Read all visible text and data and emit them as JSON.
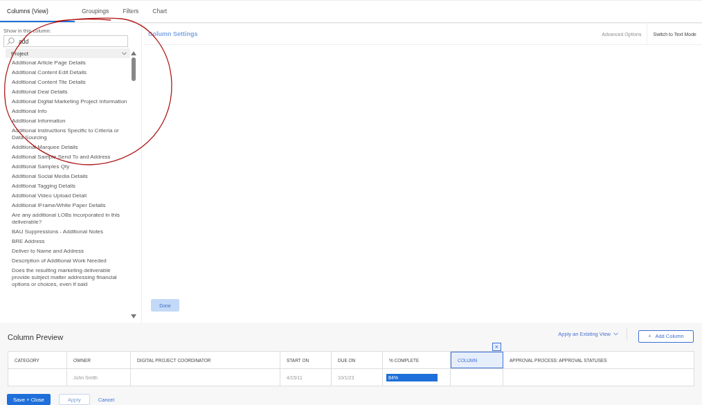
{
  "tabs": [
    {
      "label": "Columns (View)",
      "selected": true
    },
    {
      "label": "Groupings",
      "selected": false
    },
    {
      "label": "Filters",
      "selected": false
    },
    {
      "label": "Chart",
      "selected": false
    }
  ],
  "field_panel": {
    "label": "Show in this column:",
    "search": {
      "value": "add"
    },
    "group": {
      "label": "Project",
      "expanded": true
    },
    "items": [
      "Additional Article Page Details",
      "Additional Content Edit Details",
      "Additional Content Tile Details",
      "Additional Deal Details",
      "Additional Digital Marketing Project Information",
      "Additional Info",
      "Additional Information",
      "Additional Instructions Specific to Criteria or Data Sourcing",
      "Additional Marquee Details",
      "Additional Sample Send To and Address",
      "Additional Samples Qty",
      "Additional Social Media Details",
      "Additional Tagging Details",
      "Additional Video Upload Detail",
      "Additional IFrame/White Paper Details",
      "Are any additional LOBs incorporated in this deliverable?",
      "BAU Suppressions - Additional Notes",
      "BRE Address",
      "Deliver to Name and Address",
      "Description of Additional Work Needed",
      "Does the resulting marketing deliverable provide subject matter addressing financial options or choices, even if said"
    ]
  },
  "settings": {
    "title": "Column Settings",
    "advanced_options": {
      "label": "Advanced Options",
      "disabled": true
    },
    "switch_mode": "Switch to Text Mode",
    "done": {
      "label": "Done",
      "disabled": true
    }
  },
  "preview": {
    "title": "Column Preview",
    "apply_view": "Apply an Existing View",
    "add_column": "Add Column",
    "add_icon": "+",
    "columns": [
      {
        "label": "CATEGORY",
        "selected": false
      },
      {
        "label": "OWNER",
        "selected": false
      },
      {
        "label": "DIGITAL PROJECT COORDINATOR",
        "selected": false
      },
      {
        "label": "START ON",
        "selected": false
      },
      {
        "label": "DUE ON",
        "selected": false
      },
      {
        "label": "% COMPLETE",
        "selected": false
      },
      {
        "label": "COLUMN",
        "selected": true
      },
      {
        "label": "APPROVAL PROCESS: APPROVAL STATUSES",
        "selected": false
      }
    ],
    "remove_icon": "×",
    "row": [
      {
        "kind": "empty"
      },
      {
        "kind": "text",
        "text": "John Smith"
      },
      {
        "kind": "empty"
      },
      {
        "kind": "text",
        "text": "4/15/11"
      },
      {
        "kind": "text",
        "text": "10/1/23"
      },
      {
        "kind": "progress",
        "text": "84%",
        "level": 0.84
      },
      {
        "kind": "empty"
      },
      {
        "kind": "empty"
      }
    ]
  },
  "footer": {
    "save": "Save + Close",
    "apply": {
      "label": "Apply",
      "disabled": true
    },
    "cancel": "Cancel"
  },
  "annotation": {
    "shown": true
  }
}
